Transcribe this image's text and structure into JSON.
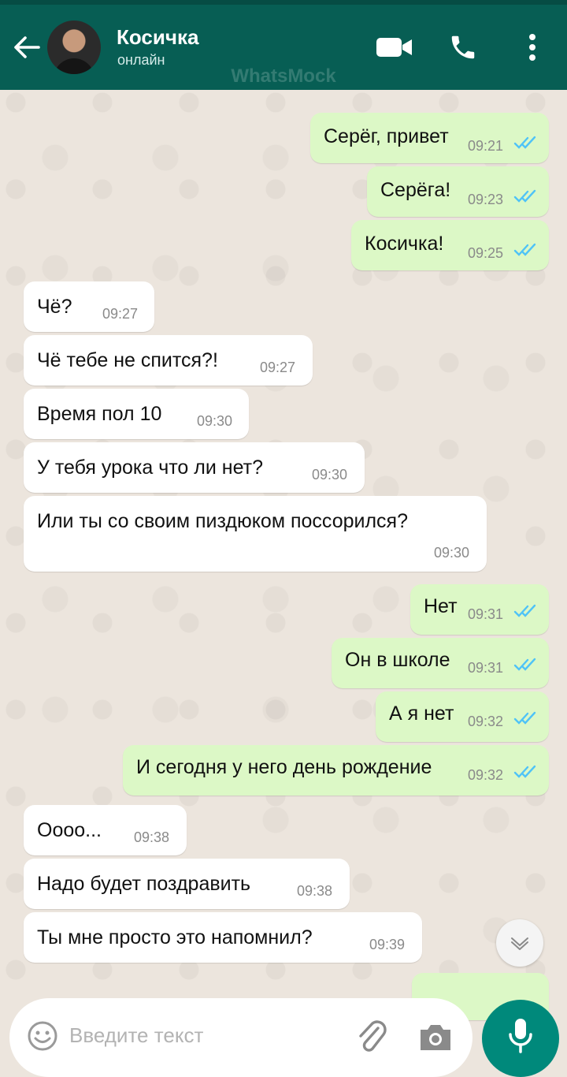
{
  "header": {
    "contact_name": "Косичка",
    "status": "онлайн",
    "watermark": "WhatsMock"
  },
  "messages": [
    {
      "dir": "out",
      "text": "Серёг, привет",
      "time": "09:21",
      "read": true
    },
    {
      "dir": "out",
      "text": "Серёга!",
      "time": "09:23",
      "read": true
    },
    {
      "dir": "out",
      "text": "Косичка!",
      "time": "09:25",
      "read": true
    },
    {
      "dir": "in",
      "text": "Чё?",
      "time": "09:27"
    },
    {
      "dir": "in",
      "text": "Чё тебе не спится?!",
      "time": "09:27"
    },
    {
      "dir": "in",
      "text": "Время пол 10",
      "time": "09:30"
    },
    {
      "dir": "in",
      "text": "У тебя урока что ли нет?",
      "time": "09:30"
    },
    {
      "dir": "in",
      "text": "Или ты со своим пиздюком поссорился?",
      "time": "09:30"
    },
    {
      "dir": "out",
      "text": "Нет",
      "time": "09:31",
      "read": true
    },
    {
      "dir": "out",
      "text": "Он в школе",
      "time": "09:31",
      "read": true
    },
    {
      "dir": "out",
      "text": "А я нет",
      "time": "09:32",
      "read": true
    },
    {
      "dir": "out",
      "text": "И сегодня у него день рождение",
      "time": "09:32",
      "read": true
    },
    {
      "dir": "in",
      "text": "Оооо...",
      "time": "09:38"
    },
    {
      "dir": "in",
      "text": "Надо будет поздравить",
      "time": "09:38"
    },
    {
      "dir": "in",
      "text": "Ты мне просто это напомнил?",
      "time": "09:39"
    }
  ],
  "composer": {
    "placeholder": "Введите текст"
  },
  "colors": {
    "header": "#075e54",
    "outgoing_bubble": "#dcf8c6",
    "incoming_bubble": "#ffffff",
    "read_ticks": "#4fc3f7",
    "mic_button": "#00897b",
    "chat_background": "#ece5dd"
  },
  "icons": [
    "back-arrow-icon",
    "video-call-icon",
    "phone-icon",
    "more-vert-icon",
    "scroll-down-icon",
    "emoji-icon",
    "attach-icon",
    "camera-icon",
    "mic-icon",
    "double-check-icon"
  ]
}
